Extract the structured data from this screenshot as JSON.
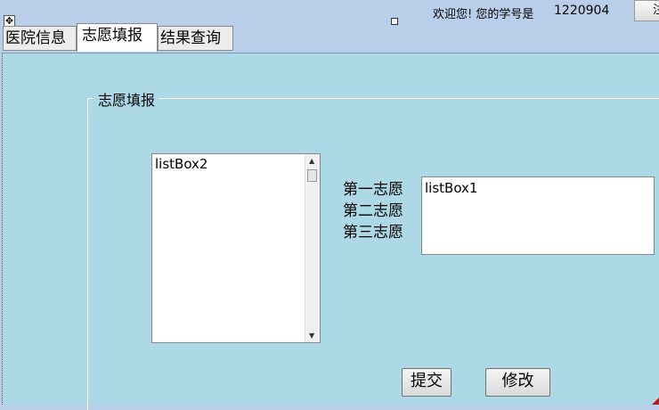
{
  "header": {
    "welcome_text": "欢迎您! 您的学号是",
    "student_number": "1220904",
    "top_button_label": "注"
  },
  "tabs": [
    {
      "label": "医院信息",
      "active": false
    },
    {
      "label": "志愿填报",
      "active": true
    },
    {
      "label": "结果查询",
      "active": false
    }
  ],
  "form": {
    "group_title": "志愿填报",
    "list_left_item": "listBox2",
    "choice_labels": [
      "第一志愿",
      "第二志愿",
      "第三志愿"
    ],
    "list_right_item": "listBox1",
    "submit_label": "提交",
    "modify_label": "修改"
  },
  "colors": {
    "background": "#b9cfe9",
    "panel": "#add8e6"
  },
  "icons": {
    "move_handle": "move-icon",
    "scroll_up": "arrow-up-icon",
    "scroll_down": "arrow-down-icon"
  }
}
